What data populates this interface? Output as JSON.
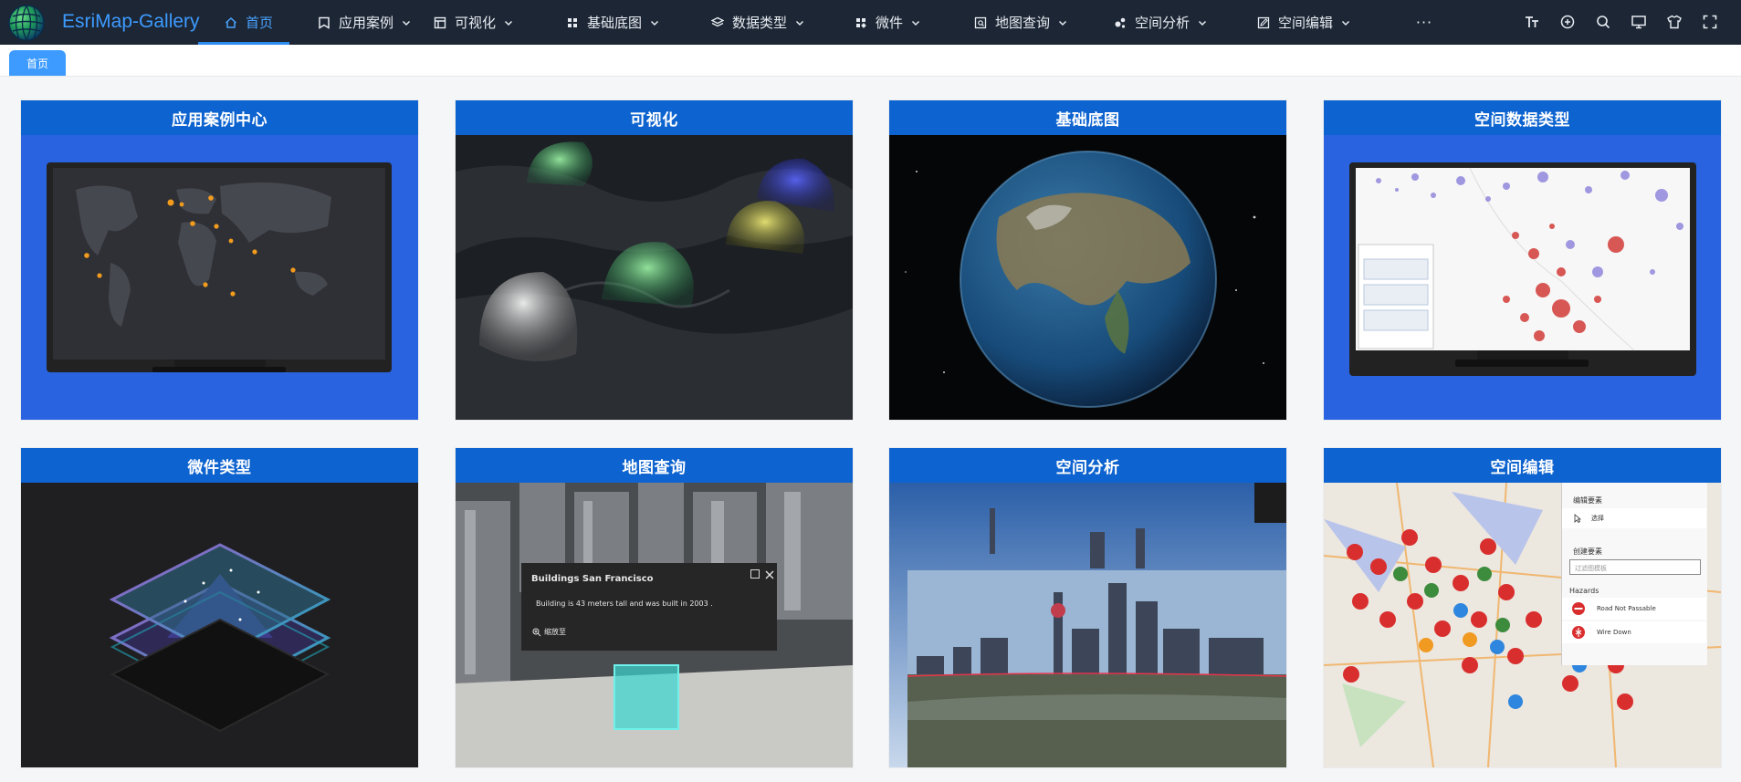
{
  "app": {
    "brand": "EsriMap-Gallery"
  },
  "nav": {
    "items": [
      {
        "label": "首页",
        "icon": "home-icon",
        "dropdown": false,
        "active": true
      },
      {
        "label": "应用案例",
        "icon": "bookmark-icon",
        "dropdown": true,
        "active": false
      },
      {
        "label": "可视化",
        "icon": "layers-icon",
        "dropdown": true,
        "active": false
      },
      {
        "label": "基础底图",
        "icon": "grid-icon",
        "dropdown": true,
        "active": false
      },
      {
        "label": "数据类型",
        "icon": "stack-icon",
        "dropdown": true,
        "active": false
      },
      {
        "label": "微件",
        "icon": "widgets-icon",
        "dropdown": true,
        "active": false
      },
      {
        "label": "地图查询",
        "icon": "map-search-icon",
        "dropdown": true,
        "active": false
      },
      {
        "label": "空间分析",
        "icon": "analysis-icon",
        "dropdown": true,
        "active": false
      },
      {
        "label": "空间编辑",
        "icon": "edit-icon",
        "dropdown": true,
        "active": false
      }
    ],
    "more": "···"
  },
  "toolbar": {
    "icons": [
      "font-size-icon",
      "translate-icon",
      "search-icon",
      "monitor-icon",
      "shirt-icon",
      "fullscreen-icon"
    ]
  },
  "tabs": {
    "active_tab": "首页"
  },
  "colors": {
    "topbar_bg": "#1c2634",
    "brand": "#3d9bff",
    "accent": "#2d8cf0",
    "card_header": "#0d63cf",
    "card_body": "#2b64e0"
  },
  "cards": [
    {
      "title": "应用案例中心",
      "thumbnail": "dark-world-map-monitor"
    },
    {
      "title": "可视化",
      "thumbnail": "3d-glowing-domes-map"
    },
    {
      "title": "基础底图",
      "thumbnail": "earth-globe"
    },
    {
      "title": "空间数据类型",
      "thumbnail": "proportional-symbols-monitor"
    },
    {
      "title": "微件类型",
      "thumbnail": "layered-terrain-isometric"
    },
    {
      "title": "地图查询",
      "thumbnail": "3d-buildings-popup",
      "popup": {
        "title": "Buildings San Francisco",
        "text": "Building is 43 meters tall and was built in 2003 .",
        "zoom": "缩放至"
      }
    },
    {
      "title": "空间分析",
      "thumbnail": "shanghai-skyline-3d"
    },
    {
      "title": "空间编辑",
      "thumbnail": "hazard-editing-map",
      "panel": {
        "section1": "编辑要素",
        "select": "选择",
        "section2": "创建要素",
        "filter_placeholder": "过滤图模板",
        "group": "Hazards",
        "items": [
          "Road Not Passable",
          "Wire Down"
        ]
      }
    }
  ]
}
